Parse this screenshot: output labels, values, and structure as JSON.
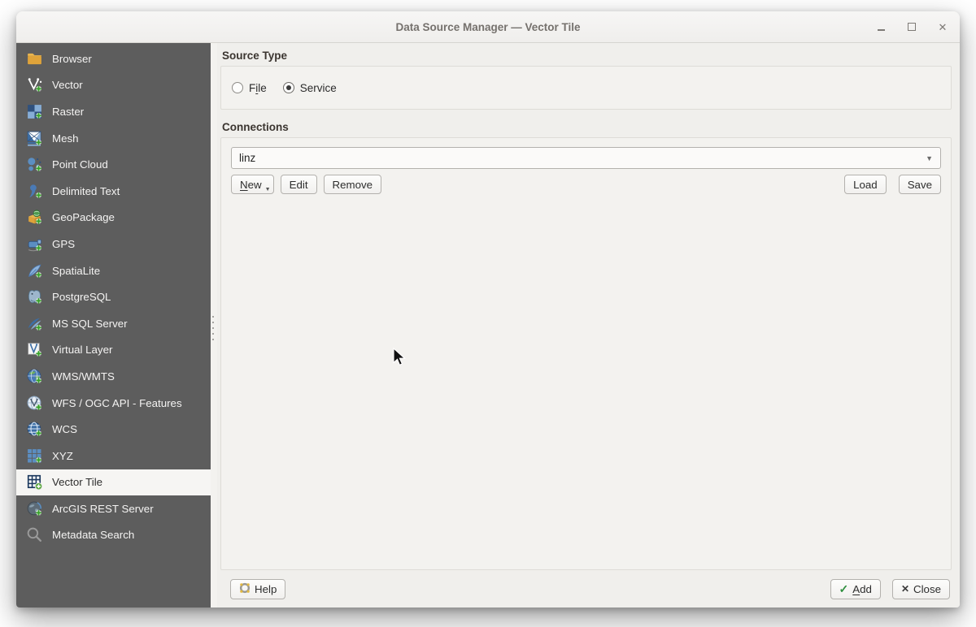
{
  "window": {
    "title": "Data Source Manager — Vector Tile",
    "controls": [
      "minimize-icon",
      "maximize-icon",
      "close-icon"
    ]
  },
  "sidebar": {
    "items": [
      {
        "label": "Browser",
        "icon": "folder-icon",
        "plus": false,
        "selected": false
      },
      {
        "label": "Vector",
        "icon": "vector-icon",
        "plus": true,
        "selected": false
      },
      {
        "label": "Raster",
        "icon": "raster-icon",
        "plus": true,
        "selected": false
      },
      {
        "label": "Mesh",
        "icon": "mesh-icon",
        "plus": true,
        "selected": false
      },
      {
        "label": "Point Cloud",
        "icon": "point-cloud-icon",
        "plus": true,
        "selected": false
      },
      {
        "label": "Delimited Text",
        "icon": "delimited-text-icon",
        "plus": true,
        "selected": false
      },
      {
        "label": "GeoPackage",
        "icon": "geopackage-icon",
        "plus": true,
        "selected": false
      },
      {
        "label": "GPS",
        "icon": "gps-icon",
        "plus": true,
        "selected": false
      },
      {
        "label": "SpatiaLite",
        "icon": "spatialite-icon",
        "plus": true,
        "selected": false
      },
      {
        "label": "PostgreSQL",
        "icon": "postgresql-icon",
        "plus": true,
        "selected": false
      },
      {
        "label": "MS SQL Server",
        "icon": "mssql-icon",
        "plus": true,
        "selected": false
      },
      {
        "label": "Virtual Layer",
        "icon": "virtual-layer-icon",
        "plus": true,
        "selected": false
      },
      {
        "label": "WMS/WMTS",
        "icon": "wms-icon",
        "plus": true,
        "selected": false
      },
      {
        "label": "WFS / OGC API - Features",
        "icon": "wfs-icon",
        "plus": true,
        "selected": false
      },
      {
        "label": "WCS",
        "icon": "wcs-icon",
        "plus": true,
        "selected": false
      },
      {
        "label": "XYZ",
        "icon": "xyz-icon",
        "plus": true,
        "selected": false
      },
      {
        "label": "Vector Tile",
        "icon": "vector-tile-icon",
        "plus": true,
        "selected": true
      },
      {
        "label": "ArcGIS REST Server",
        "icon": "arcgis-icon",
        "plus": true,
        "selected": false
      },
      {
        "label": "Metadata Search",
        "icon": "metadata-search-icon",
        "plus": false,
        "selected": false
      }
    ]
  },
  "source_type": {
    "heading": "Source Type",
    "options": [
      {
        "label": "File",
        "selected": false,
        "underline": 1
      },
      {
        "label": "Service",
        "selected": true
      }
    ]
  },
  "connections": {
    "heading": "Connections",
    "selected_connection": "linz",
    "buttons": {
      "new": "New",
      "edit": "Edit",
      "remove": "Remove",
      "load": "Load",
      "save": "Save"
    }
  },
  "footer": {
    "help": "Help",
    "add": "Add",
    "close": "Close"
  },
  "colors": {
    "sidebar_bg": "#5d5d5d",
    "selected_item_bg": "#f6f5f3",
    "main_bg": "#f0efec",
    "accent_blue": "#4a7ab5",
    "plus_green": "#36a028",
    "check_green": "#2f8f3f"
  }
}
